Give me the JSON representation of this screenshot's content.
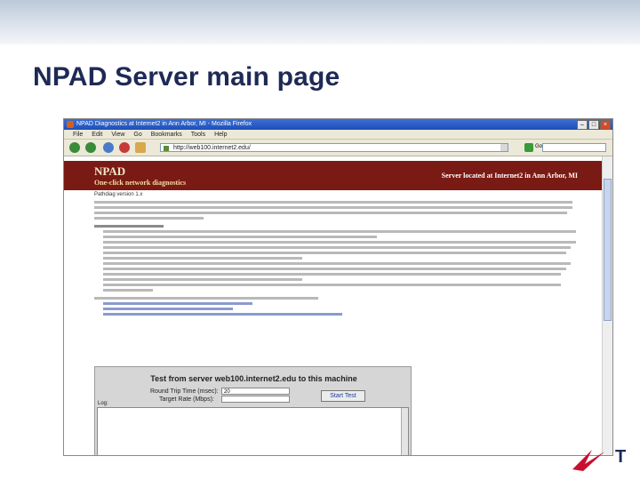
{
  "slide": {
    "title": "NPAD Server main page"
  },
  "browser": {
    "window_title": "NPAD Diagnostics at Internet2 in Ann Arbor, MI - Mozilla Firefox",
    "menu": [
      "File",
      "Edit",
      "View",
      "Go",
      "Bookmarks",
      "Tools",
      "Help"
    ],
    "address": "http://web100.internet2.edu/",
    "go_label": "Go",
    "search_value": ""
  },
  "page": {
    "brand": "NPAD",
    "tagline": "One-click network diagnostics",
    "server_location": "Server located at Internet2 in Ann Arbor, MI",
    "version_line": "Pathdiag version 1.x"
  },
  "applet": {
    "heading": "Test from server web100.internet2.edu to this machine",
    "rtt_label": "Round Trip Time (msec):",
    "rtt_value": "20",
    "rate_label": "Target Rate (Mbps):",
    "rate_value": "",
    "start_label": "Start Test",
    "log_label": "Log:"
  },
  "colors": {
    "banner_bg": "#7a1a14",
    "title_color": "#1e2a55"
  }
}
